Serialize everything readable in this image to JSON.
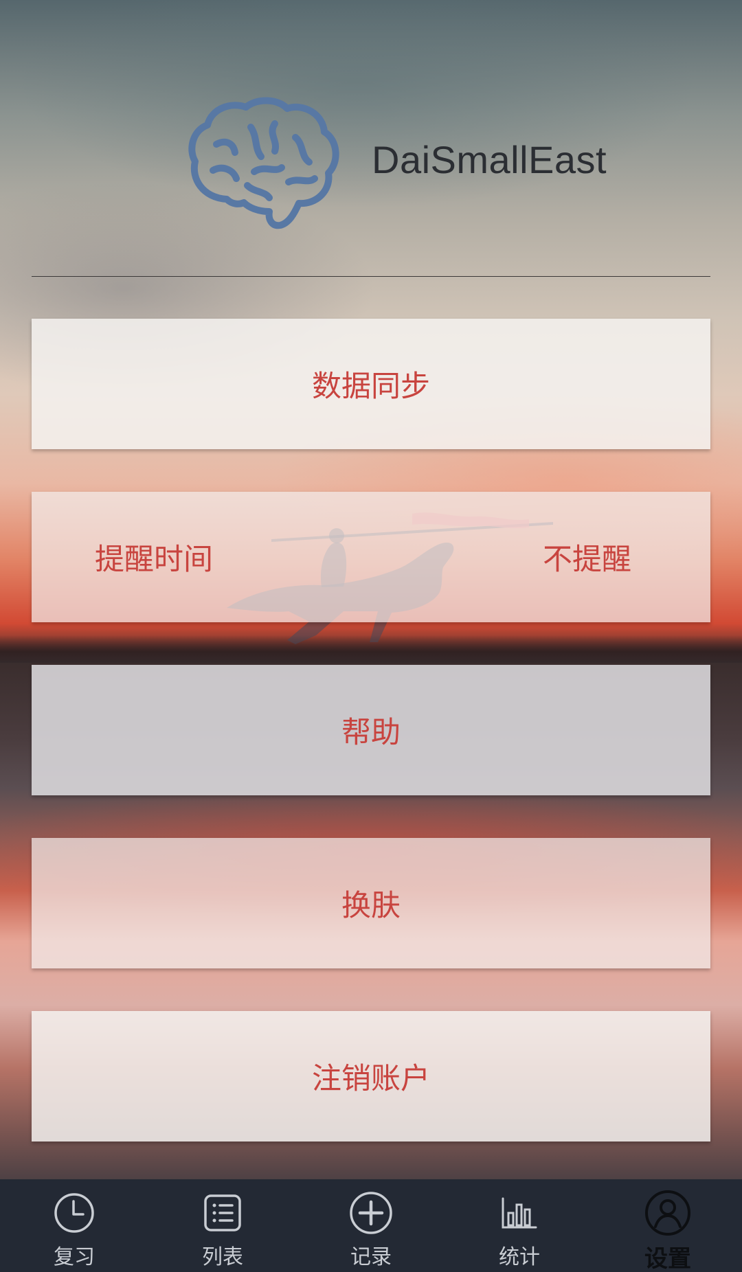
{
  "header": {
    "app_name": "DaiSmallEast",
    "logo_icon": "brain-icon"
  },
  "menu": {
    "data_sync": "数据同步",
    "reminder_label": "提醒时间",
    "reminder_value": "不提醒",
    "help": "帮助",
    "skin": "换肤",
    "logout": "注销账户"
  },
  "bottom_nav": {
    "items": [
      {
        "label": "复习",
        "icon": "clock-icon"
      },
      {
        "label": "列表",
        "icon": "list-icon"
      },
      {
        "label": "记录",
        "icon": "plus-circle-icon"
      },
      {
        "label": "统计",
        "icon": "bar-chart-icon"
      },
      {
        "label": "设置",
        "icon": "user-icon",
        "active": true
      }
    ]
  },
  "colors": {
    "accent_text": "#c8443f",
    "nav_background": "#232934",
    "logo_blue": "#5878a4"
  }
}
